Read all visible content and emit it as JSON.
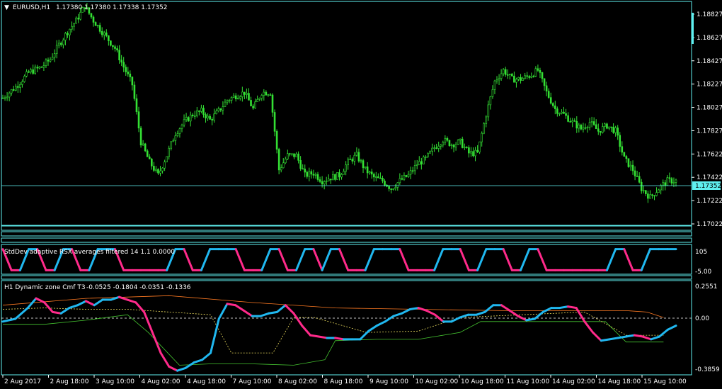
{
  "colors": {
    "background": "#000000",
    "frame": "#5ff0f0",
    "bull": "#34e134",
    "bear": "#34e134",
    "rsx_up": "#20b8f0",
    "rsx_down": "#ff2a8a",
    "cmf_upper": "#ff7a22",
    "cmf_lower": "#44c230",
    "cmf_mid": "#f0e060",
    "zero_line": "#ffffff",
    "text": "#ffffff",
    "price_tag_bg": "#5ff0f0"
  },
  "header": {
    "arrow": "▼",
    "symbol_tf": "EURUSD,H1",
    "ohlc": "1.17380 1.17380 1.17338 1.17352"
  },
  "indicators": {
    "rsx_title": "StdDev adaptive RSX averages filtered 14 1.1 0.0000",
    "rsx_scale": [
      "105",
      "-5.00"
    ],
    "cmf_title": "H1 Dynamic zone Cmf T3",
    "cmf_values": "-0.0525 -0.1804 -0.0351 -0.1336",
    "cmf_scale": [
      "0.2551",
      "0.00",
      "-0.3859"
    ]
  },
  "current_price": "1.17352",
  "chart_data": {
    "type": "candlestick",
    "price_axis": [
      "1.18827",
      "1.18627",
      "1.18427",
      "1.18227",
      "1.18027",
      "1.17827",
      "1.17622",
      "1.17422",
      "1.17222",
      "1.17022"
    ],
    "ylim": [
      1.1696,
      1.1896
    ],
    "time_axis": [
      "2 Aug 2017",
      "2 Aug 18:00",
      "3 Aug 10:00",
      "4 Aug 02:00",
      "4 Aug 18:00",
      "7 Aug 10:00",
      "8 Aug 02:00",
      "8 Aug 18:00",
      "9 Aug 10:00",
      "10 Aug 02:00",
      "10 Aug 18:00",
      "11 Aug 10:00",
      "14 Aug 02:00",
      "14 Aug 18:00",
      "15 Aug 10:00"
    ],
    "close_path": [
      [
        0,
        1.181
      ],
      [
        6,
        1.182
      ],
      [
        12,
        1.1833
      ],
      [
        18,
        1.1838
      ],
      [
        22,
        1.1845
      ],
      [
        26,
        1.1858
      ],
      [
        30,
        1.187
      ],
      [
        34,
        1.188
      ],
      [
        38,
        1.1893
      ],
      [
        42,
        1.188
      ],
      [
        48,
        1.1865
      ],
      [
        52,
        1.1855
      ],
      [
        56,
        1.1838
      ],
      [
        60,
        1.1822
      ],
      [
        64,
        1.177
      ],
      [
        68,
        1.1752
      ],
      [
        72,
        1.174
      ],
      [
        76,
        1.1758
      ],
      [
        80,
        1.1778
      ],
      [
        84,
        1.1788
      ],
      [
        88,
        1.1795
      ],
      [
        92,
        1.1798
      ],
      [
        96,
        1.179
      ],
      [
        100,
        1.1798
      ],
      [
        104,
        1.1808
      ],
      [
        108,
        1.1812
      ],
      [
        112,
        1.1815
      ],
      [
        116,
        1.18
      ],
      [
        120,
        1.1815
      ],
      [
        124,
        1.1815
      ],
      [
        128,
        1.1745
      ],
      [
        132,
        1.1758
      ],
      [
        136,
        1.1758
      ],
      [
        140,
        1.174
      ],
      [
        144,
        1.1742
      ],
      [
        148,
        1.1735
      ],
      [
        152,
        1.1738
      ],
      [
        156,
        1.174
      ],
      [
        160,
        1.1752
      ],
      [
        164,
        1.1758
      ],
      [
        168,
        1.1745
      ],
      [
        172,
        1.1738
      ],
      [
        176,
        1.1735
      ],
      [
        180,
        1.1728
      ],
      [
        184,
        1.1735
      ],
      [
        188,
        1.174
      ],
      [
        192,
        1.175
      ],
      [
        196,
        1.1755
      ],
      [
        200,
        1.1765
      ],
      [
        204,
        1.1772
      ],
      [
        208,
        1.1768
      ],
      [
        212,
        1.177
      ],
      [
        216,
        1.176
      ],
      [
        220,
        1.176
      ],
      [
        224,
        1.1795
      ],
      [
        228,
        1.1825
      ],
      [
        232,
        1.1835
      ],
      [
        236,
        1.1827
      ],
      [
        240,
        1.1827
      ],
      [
        244,
        1.183
      ],
      [
        248,
        1.1835
      ],
      [
        252,
        1.1815
      ],
      [
        256,
        1.18
      ],
      [
        260,
        1.1795
      ],
      [
        264,
        1.1788
      ],
      [
        268,
        1.1782
      ],
      [
        272,
        1.1788
      ],
      [
        276,
        1.178
      ],
      [
        280,
        1.1785
      ],
      [
        284,
        1.178
      ],
      [
        288,
        1.1755
      ],
      [
        292,
        1.1745
      ],
      [
        296,
        1.1728
      ],
      [
        300,
        1.172
      ],
      [
        304,
        1.1728
      ],
      [
        308,
        1.1735
      ],
      [
        312,
        1.1735
      ]
    ],
    "rsx_path": [
      [
        0,
        0.95
      ],
      [
        4,
        0.05
      ],
      [
        8,
        0.05
      ],
      [
        12,
        0.95
      ],
      [
        16,
        0.95
      ],
      [
        20,
        0.05
      ],
      [
        24,
        0.05
      ],
      [
        28,
        0.95
      ],
      [
        32,
        0.95
      ],
      [
        36,
        0.05
      ],
      [
        40,
        0.05
      ],
      [
        44,
        0.95
      ],
      [
        48,
        0.95
      ],
      [
        52,
        0.95
      ],
      [
        56,
        0.05
      ],
      [
        60,
        0.05
      ],
      [
        64,
        0.05
      ],
      [
        68,
        0.05
      ],
      [
        72,
        0.05
      ],
      [
        76,
        0.05
      ],
      [
        80,
        0.95
      ],
      [
        84,
        0.95
      ],
      [
        88,
        0.05
      ],
      [
        92,
        0.05
      ],
      [
        96,
        0.95
      ],
      [
        100,
        0.95
      ],
      [
        104,
        0.95
      ],
      [
        108,
        0.95
      ],
      [
        112,
        0.05
      ],
      [
        116,
        0.05
      ],
      [
        120,
        0.05
      ],
      [
        124,
        0.95
      ],
      [
        128,
        0.95
      ],
      [
        132,
        0.05
      ],
      [
        136,
        0.05
      ],
      [
        140,
        0.95
      ],
      [
        144,
        0.95
      ],
      [
        148,
        0.05
      ],
      [
        152,
        0.95
      ],
      [
        156,
        0.95
      ],
      [
        160,
        0.05
      ],
      [
        164,
        0.05
      ],
      [
        168,
        0.05
      ],
      [
        172,
        0.95
      ],
      [
        176,
        0.95
      ],
      [
        180,
        0.95
      ],
      [
        184,
        0.95
      ],
      [
        188,
        0.05
      ],
      [
        192,
        0.05
      ],
      [
        196,
        0.05
      ],
      [
        200,
        0.05
      ],
      [
        204,
        0.95
      ],
      [
        208,
        0.95
      ],
      [
        212,
        0.95
      ],
      [
        216,
        0.05
      ],
      [
        220,
        0.05
      ],
      [
        224,
        0.95
      ],
      [
        228,
        0.95
      ],
      [
        232,
        0.95
      ],
      [
        236,
        0.05
      ],
      [
        240,
        0.05
      ],
      [
        244,
        0.95
      ],
      [
        248,
        0.95
      ],
      [
        252,
        0.05
      ],
      [
        256,
        0.05
      ],
      [
        260,
        0.05
      ],
      [
        264,
        0.05
      ],
      [
        268,
        0.05
      ],
      [
        272,
        0.05
      ],
      [
        276,
        0.05
      ],
      [
        280,
        0.05
      ],
      [
        284,
        0.95
      ],
      [
        288,
        0.95
      ],
      [
        292,
        0.05
      ],
      [
        296,
        0.05
      ],
      [
        300,
        0.95
      ],
      [
        304,
        0.95
      ],
      [
        308,
        0.95
      ],
      [
        312,
        0.95
      ]
    ],
    "cmf": {
      "ylim": [
        -0.4,
        0.27
      ],
      "line": [
        [
          0,
          -0.02
        ],
        [
          6,
          0.0
        ],
        [
          12,
          0.08
        ],
        [
          16,
          0.15
        ],
        [
          20,
          0.12
        ],
        [
          24,
          0.05
        ],
        [
          28,
          0.04
        ],
        [
          32,
          0.08
        ],
        [
          36,
          0.1
        ],
        [
          40,
          0.13
        ],
        [
          44,
          0.1
        ],
        [
          48,
          0.14
        ],
        [
          52,
          0.14
        ],
        [
          56,
          0.16
        ],
        [
          60,
          0.14
        ],
        [
          64,
          0.12
        ],
        [
          68,
          0.05
        ],
        [
          72,
          -0.1
        ],
        [
          76,
          -0.25
        ],
        [
          80,
          -0.35
        ],
        [
          84,
          -0.38
        ],
        [
          88,
          -0.36
        ],
        [
          92,
          -0.32
        ],
        [
          96,
          -0.3
        ],
        [
          100,
          -0.25
        ],
        [
          104,
          0.0
        ],
        [
          108,
          0.11
        ],
        [
          112,
          0.1
        ],
        [
          116,
          0.06
        ],
        [
          120,
          0.02
        ],
        [
          124,
          0.02
        ],
        [
          128,
          0.04
        ],
        [
          132,
          0.05
        ],
        [
          136,
          0.1
        ],
        [
          140,
          0.04
        ],
        [
          144,
          -0.05
        ],
        [
          148,
          -0.12
        ],
        [
          152,
          -0.13
        ],
        [
          156,
          -0.14
        ],
        [
          160,
          -0.14
        ],
        [
          164,
          -0.15
        ],
        [
          168,
          -0.15
        ],
        [
          172,
          -0.15
        ],
        [
          176,
          -0.09
        ],
        [
          180,
          -0.05
        ],
        [
          184,
          -0.02
        ],
        [
          188,
          0.02
        ],
        [
          192,
          0.04
        ],
        [
          196,
          0.07
        ],
        [
          200,
          0.08
        ],
        [
          204,
          0.06
        ],
        [
          208,
          0.03
        ],
        [
          212,
          -0.02
        ],
        [
          216,
          -0.02
        ],
        [
          220,
          0.01
        ],
        [
          224,
          0.03
        ],
        [
          228,
          0.03
        ],
        [
          232,
          0.05
        ],
        [
          236,
          0.1
        ],
        [
          240,
          0.1
        ],
        [
          244,
          0.06
        ],
        [
          248,
          0.02
        ],
        [
          252,
          -0.01
        ],
        [
          256,
          0.0
        ],
        [
          260,
          0.05
        ],
        [
          264,
          0.08
        ],
        [
          268,
          0.08
        ],
        [
          272,
          0.09
        ],
        [
          276,
          0.08
        ],
        [
          280,
          -0.02
        ],
        [
          284,
          -0.1
        ],
        [
          288,
          -0.16
        ],
        [
          292,
          -0.15
        ],
        [
          296,
          -0.14
        ],
        [
          300,
          -0.13
        ],
        [
          304,
          -0.12
        ],
        [
          308,
          -0.13
        ],
        [
          312,
          -0.15
        ],
        [
          316,
          -0.13
        ],
        [
          320,
          -0.08
        ],
        [
          324,
          -0.05
        ]
      ],
      "upper": [
        [
          0,
          0.1
        ],
        [
          40,
          0.15
        ],
        [
          80,
          0.17
        ],
        [
          120,
          0.12
        ],
        [
          160,
          0.08
        ],
        [
          200,
          0.07
        ],
        [
          240,
          0.06
        ],
        [
          280,
          0.06
        ],
        [
          300,
          0.06
        ],
        [
          310,
          0.05
        ],
        [
          318,
          0.01
        ]
      ],
      "lower": [
        [
          0,
          -0.04
        ],
        [
          20,
          -0.04
        ],
        [
          40,
          -0.01
        ],
        [
          60,
          0.03
        ],
        [
          70,
          -0.1
        ],
        [
          85,
          -0.34
        ],
        [
          100,
          -0.33
        ],
        [
          120,
          -0.33
        ],
        [
          140,
          -0.34
        ],
        [
          155,
          -0.3
        ],
        [
          160,
          -0.16
        ],
        [
          180,
          -0.15
        ],
        [
          200,
          -0.15
        ],
        [
          220,
          -0.1
        ],
        [
          230,
          -0.02
        ],
        [
          250,
          -0.02
        ],
        [
          270,
          -0.02
        ],
        [
          290,
          -0.02
        ],
        [
          300,
          -0.17
        ],
        [
          318,
          -0.17
        ]
      ],
      "mid": [
        [
          0,
          0.07
        ],
        [
          20,
          0.08
        ],
        [
          40,
          0.07
        ],
        [
          60,
          0.07
        ],
        [
          80,
          0.05
        ],
        [
          100,
          0.03
        ],
        [
          110,
          -0.25
        ],
        [
          130,
          -0.25
        ],
        [
          140,
          0.01
        ],
        [
          150,
          0.01
        ],
        [
          175,
          -0.1
        ],
        [
          200,
          -0.09
        ],
        [
          220,
          0.01
        ],
        [
          250,
          0.03
        ],
        [
          280,
          0.05
        ],
        [
          300,
          -0.12
        ],
        [
          318,
          -0.12
        ]
      ]
    }
  }
}
